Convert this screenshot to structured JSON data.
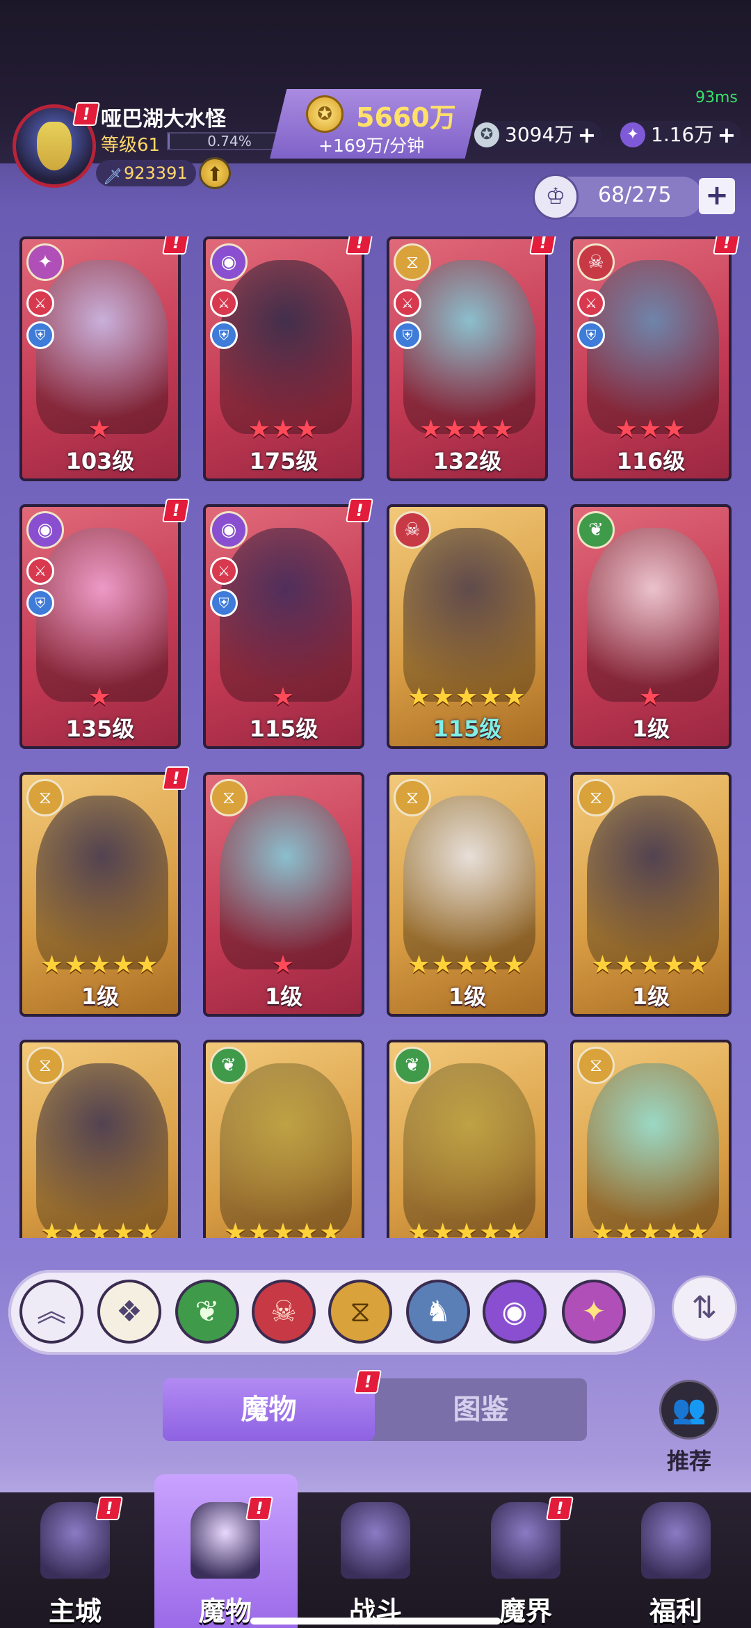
{
  "status": {
    "ping": "93ms"
  },
  "player": {
    "name": "哑巴湖大水怪",
    "level": "等级61",
    "xp_percent": "0.74%",
    "power": "923391"
  },
  "resources": {
    "gold": "5660万",
    "gold_rate": "+169万/分钟",
    "silver": "3094万",
    "gems": "1.16万"
  },
  "capacity": "68/275",
  "cards": [
    {
      "level": "103级",
      "stars": "★",
      "star_color": "red",
      "frame": "red",
      "alert": true
    },
    {
      "level": "175级",
      "stars": "★★★",
      "star_color": "red",
      "frame": "red",
      "alert": true
    },
    {
      "level": "132级",
      "stars": "★★★★",
      "star_color": "red",
      "frame": "red",
      "alert": true
    },
    {
      "level": "116级",
      "stars": "★★★",
      "star_color": "red",
      "frame": "red",
      "alert": true
    },
    {
      "level": "135级",
      "stars": "★",
      "star_color": "red",
      "frame": "red",
      "alert": true
    },
    {
      "level": "115级",
      "stars": "★",
      "star_color": "red",
      "frame": "red",
      "alert": true
    },
    {
      "level": "115级",
      "stars": "★★★★★",
      "star_color": "gold",
      "frame": "gold",
      "alert": false,
      "level_color": "cyan"
    },
    {
      "level": "1级",
      "stars": "★",
      "star_color": "red",
      "frame": "red",
      "alert": false
    },
    {
      "level": "1级",
      "stars": "★★★★★",
      "star_color": "gold",
      "frame": "gold",
      "alert": true
    },
    {
      "level": "1级",
      "stars": "★",
      "star_color": "red",
      "frame": "red",
      "alert": false
    },
    {
      "level": "1级",
      "stars": "★★★★★",
      "star_color": "gold",
      "frame": "gold",
      "alert": false
    },
    {
      "level": "1级",
      "stars": "★★★★★",
      "star_color": "gold",
      "frame": "gold",
      "alert": false
    },
    {
      "level": "",
      "stars": "★★★★★",
      "star_color": "gold",
      "frame": "gold",
      "alert": false
    },
    {
      "level": "",
      "stars": "★★★★★",
      "star_color": "gold",
      "frame": "gold",
      "alert": false
    },
    {
      "level": "",
      "stars": "★★★★★",
      "star_color": "gold",
      "frame": "gold",
      "alert": false
    },
    {
      "level": "",
      "stars": "★★★★★",
      "star_color": "gold",
      "frame": "gold",
      "alert": false
    }
  ],
  "filters": [
    {
      "name": "collapse-icon",
      "glyph": "︽",
      "bg": "#eeeaf6",
      "fg": "#5a4f7a"
    },
    {
      "name": "all-icon",
      "glyph": "❖",
      "bg": "#f4efe0",
      "fg": "#4f4470"
    },
    {
      "name": "nature-icon",
      "glyph": "❦",
      "bg": "#3f9a4a",
      "fg": "#e9ffe0"
    },
    {
      "name": "demon-icon",
      "glyph": "☠",
      "bg": "#c73a45",
      "fg": "#ffe0d0"
    },
    {
      "name": "time-icon",
      "glyph": "⧖",
      "bg": "#d9a23a",
      "fg": "#5a3a00"
    },
    {
      "name": "dragon-icon",
      "glyph": "♞",
      "bg": "#5a7fb6",
      "fg": "#ffffff"
    },
    {
      "name": "eye-icon",
      "glyph": "◉",
      "bg": "#8a4fd0",
      "fg": "#ffffff"
    },
    {
      "name": "chaos-icon",
      "glyph": "✦",
      "bg": "#b04fb8",
      "fg": "#ffe680"
    }
  ],
  "tabs": {
    "monsters": "魔物",
    "codex": "图鉴"
  },
  "recommend_label": "推荐",
  "nav": [
    {
      "label": "主城",
      "icon": "castle-icon",
      "alert": true
    },
    {
      "label": "魔物",
      "icon": "flame-star-icon",
      "alert": true,
      "active": true
    },
    {
      "label": "战斗",
      "icon": "sword-shield-icon",
      "alert": false
    },
    {
      "label": "魔界",
      "icon": "portal-icon",
      "alert": true
    },
    {
      "label": "福利",
      "icon": "chest-icon",
      "alert": false
    }
  ]
}
